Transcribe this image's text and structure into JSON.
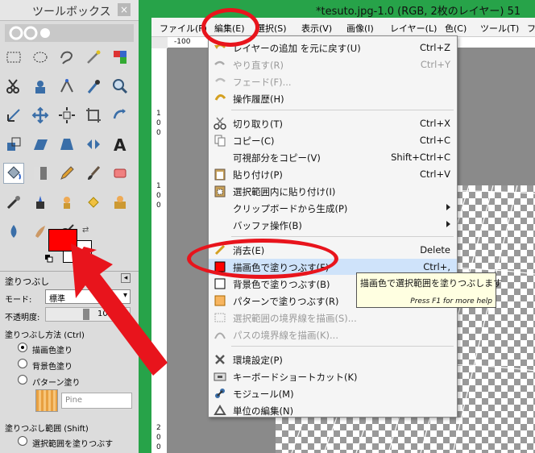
{
  "toolbox": {
    "title": "ツールボックス",
    "close": "×",
    "tools": [
      "rect-select-icon",
      "ellipse-select-icon",
      "lasso-icon",
      "fuzzy-select-icon",
      "color-select-icon",
      "scissors-select-icon",
      "foreground-select-icon",
      "paths-icon",
      "color-picker-icon",
      "zoom-icon",
      "measure-icon",
      "move-icon",
      "align-icon",
      "crop-icon",
      "rotate-icon",
      "scale-icon",
      "shear-icon",
      "perspective-icon",
      "flip-icon",
      "text-icon",
      "bucket-fill-icon",
      "blend-icon",
      "pencil-icon",
      "paintbrush-icon",
      "eraser-icon",
      "airbrush-icon",
      "ink-icon",
      "clone-icon",
      "heal-icon",
      "perspective-clone-icon",
      "blur-icon",
      "smudge-icon",
      "dodge-burn-icon"
    ],
    "fg_color": "#ff0000",
    "bg_color": "#ffffff"
  },
  "tool_options": {
    "title": "塗りつぶし",
    "mode_label": "モード:",
    "mode_value": "標準",
    "opacity_label": "不透明度:",
    "opacity_value": "100",
    "fill_type_label": "塗りつぶし方法 (Ctrl)",
    "fill_types": [
      "描画色塗り",
      "背景色塗り",
      "パターン塗り"
    ],
    "pattern_name": "Pine",
    "fill_range_label": "塗りつぶし範囲 (Shift)",
    "fill_ranges": [
      "選択範囲を塗りつぶす"
    ]
  },
  "window": {
    "title": "*tesuto.jpg-1.0 (RGB, 2枚のレイヤー) 51",
    "menus": [
      "ファイル(F)",
      "編集(E)",
      "選択(S)",
      "表示(V)",
      "画像(I)",
      "レイヤー(L)",
      "色(C)",
      "ツール(T)",
      "フ"
    ],
    "ruler_top": "-100",
    "ruler_left": [
      "1",
      "0",
      "0",
      "1",
      "0",
      "0",
      "2",
      "0",
      "0"
    ]
  },
  "edit_menu": {
    "items": [
      {
        "label": "レイヤーの追加 を元に戻す(U)",
        "accel": "Ctrl+Z",
        "icon": "undo-icon",
        "disabled": false
      },
      {
        "label": "やり直す(R)",
        "accel": "Ctrl+Y",
        "icon": "redo-icon",
        "disabled": true
      },
      {
        "label": "フェード(F)...",
        "accel": "",
        "icon": "fade-icon",
        "disabled": true
      },
      {
        "label": "操作履歴(H)",
        "accel": "",
        "icon": "history-icon",
        "disabled": false
      },
      {
        "label": "切り取り(T)",
        "accel": "Ctrl+X",
        "icon": "cut-icon",
        "disabled": false
      },
      {
        "label": "コピー(C)",
        "accel": "Ctrl+C",
        "icon": "copy-icon",
        "disabled": false
      },
      {
        "label": "可視部分をコピー(V)",
        "accel": "Shift+Ctrl+C",
        "icon": "",
        "disabled": false
      },
      {
        "label": "貼り付け(P)",
        "accel": "Ctrl+V",
        "icon": "paste-icon",
        "disabled": false
      },
      {
        "label": "選択範囲内に貼り付け(I)",
        "accel": "",
        "icon": "paste-into-icon",
        "disabled": false
      },
      {
        "label": "クリップボードから生成(P)",
        "accel": "",
        "icon": "",
        "disabled": false,
        "submenu": true
      },
      {
        "label": "バッファ操作(B)",
        "accel": "",
        "icon": "",
        "disabled": false,
        "submenu": true
      },
      {
        "label": "消去(E)",
        "accel": "Delete",
        "icon": "clear-icon",
        "disabled": false
      },
      {
        "label": "描画色で塗りつぶす(F)",
        "accel": "Ctrl+,",
        "icon": "fg-fill-icon",
        "disabled": false
      },
      {
        "label": "背景色で塗りつぶす(B)",
        "accel": "",
        "icon": "bg-fill-icon",
        "disabled": false
      },
      {
        "label": "パターンで塗りつぶす(R)",
        "accel": "",
        "icon": "pattern-fill-icon",
        "disabled": false
      },
      {
        "label": "選択範囲の境界線を描画(S)...",
        "accel": "",
        "icon": "stroke-selection-icon",
        "disabled": true
      },
      {
        "label": "パスの境界線を描画(K)...",
        "accel": "",
        "icon": "stroke-path-icon",
        "disabled": true
      },
      {
        "label": "環境設定(P)",
        "accel": "",
        "icon": "preferences-icon",
        "disabled": false
      },
      {
        "label": "キーボードショートカット(K)",
        "accel": "",
        "icon": "keyboard-icon",
        "disabled": false
      },
      {
        "label": "モジュール(M)",
        "accel": "",
        "icon": "module-icon",
        "disabled": false
      },
      {
        "label": "単位の編集(N)",
        "accel": "",
        "icon": "units-icon",
        "disabled": false
      }
    ]
  },
  "tooltip": {
    "text": "描画色で選択範囲を塗りつぶします",
    "hint": "Press F1 for more help"
  },
  "annotation": {
    "color": "#e8141c"
  }
}
